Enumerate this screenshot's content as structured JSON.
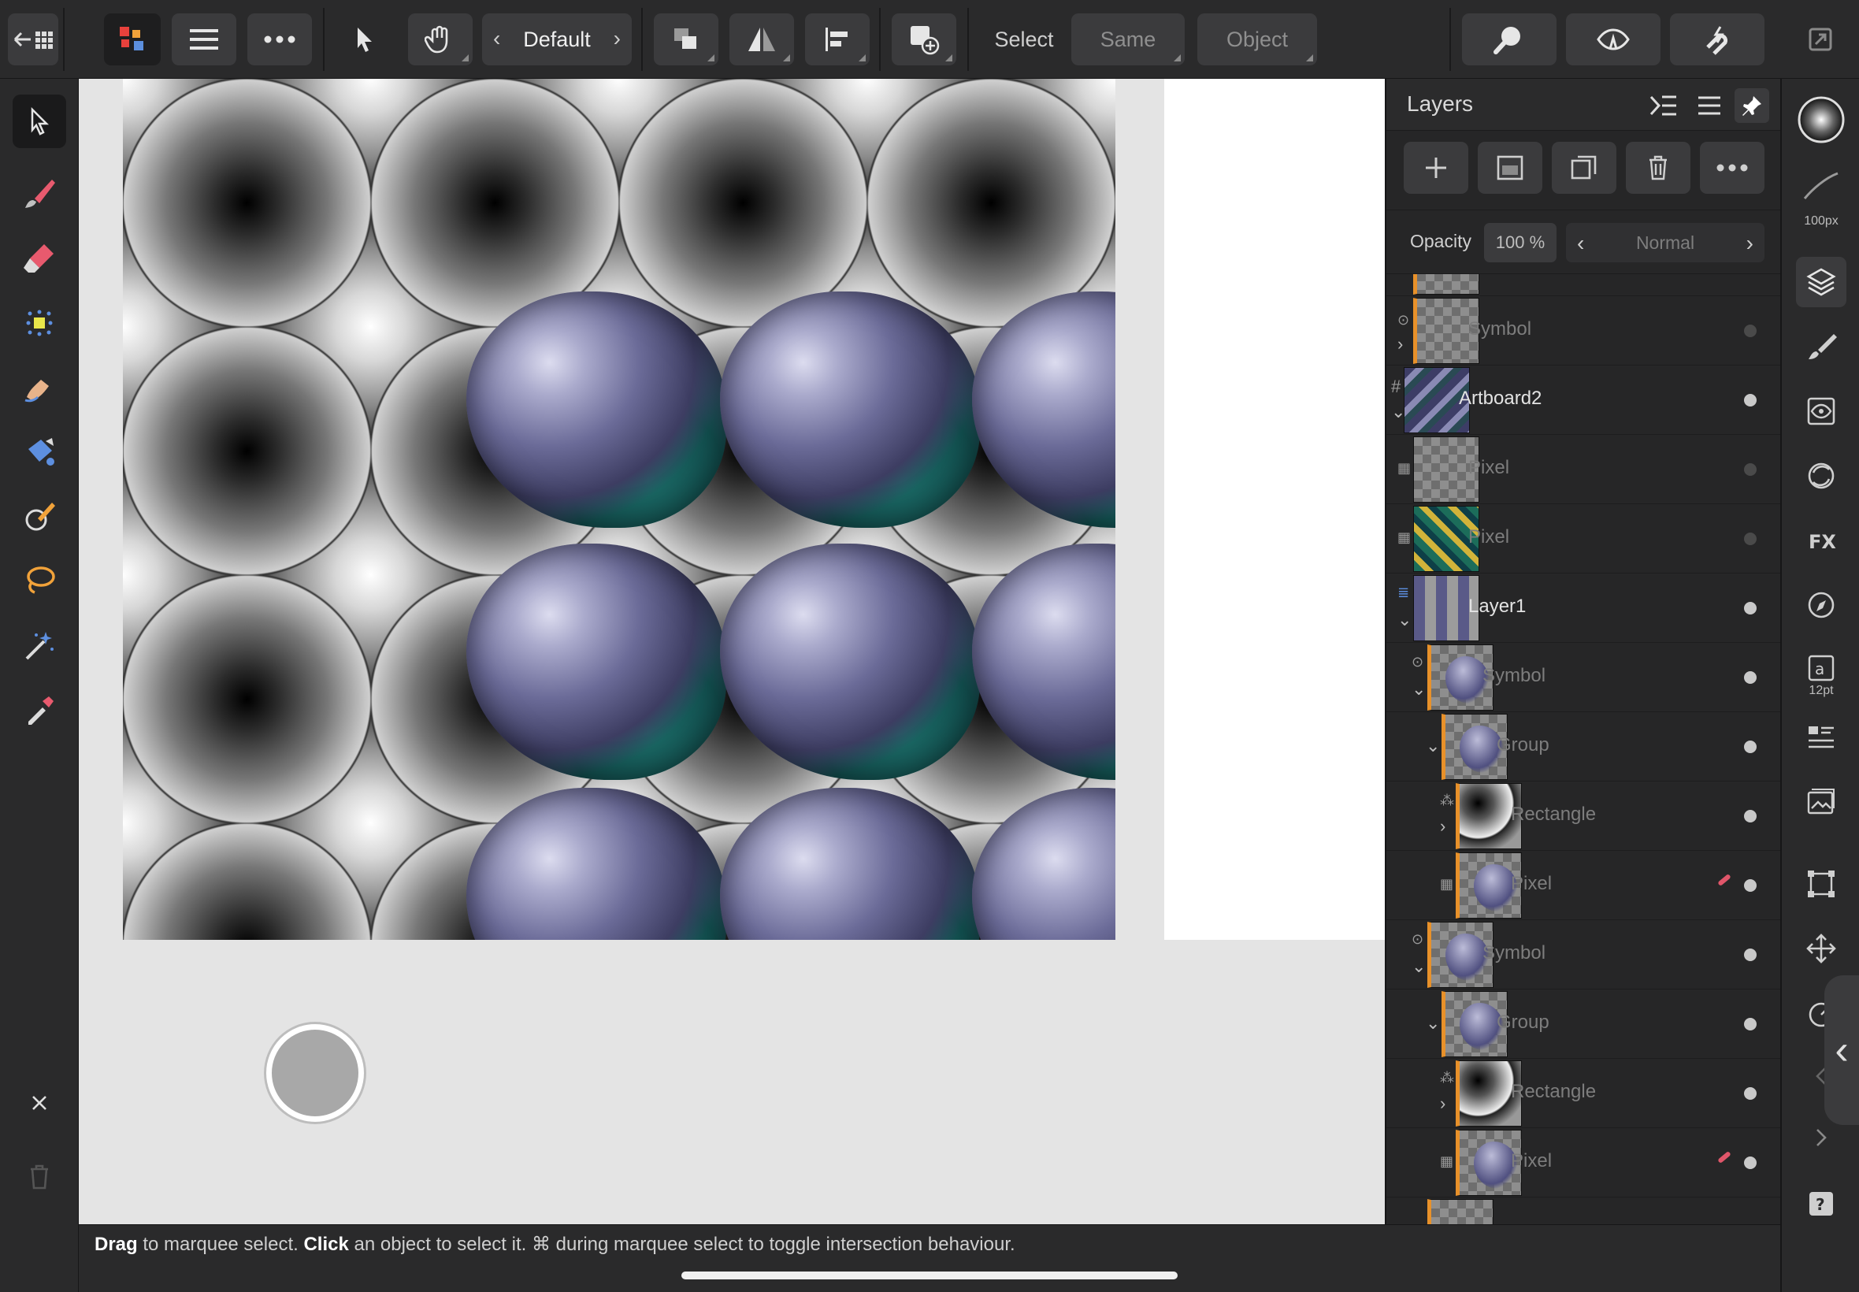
{
  "toolbar": {
    "preset": "Default",
    "select_label": "Select",
    "same_label": "Same",
    "object_label": "Object"
  },
  "layers_panel": {
    "title": "Layers",
    "opacity_label": "Opacity",
    "opacity_value": "100 %",
    "blend_mode": "Normal",
    "rows": [
      {
        "name": "Symbol",
        "kind": "symbol"
      },
      {
        "name": "Artboard2",
        "kind": "artboard"
      },
      {
        "name": "Pixel",
        "kind": "pixel"
      },
      {
        "name": "Pixel",
        "kind": "pixel"
      },
      {
        "name": "Layer1",
        "kind": "layer"
      },
      {
        "name": "Symbol",
        "kind": "symbol"
      },
      {
        "name": "Group",
        "kind": "group"
      },
      {
        "name": "Rectangle",
        "kind": "rectangle"
      },
      {
        "name": "Pixel",
        "kind": "pixel"
      },
      {
        "name": "Symbol",
        "kind": "symbol"
      },
      {
        "name": "Group",
        "kind": "group"
      },
      {
        "name": "Rectangle",
        "kind": "rectangle"
      },
      {
        "name": "Pixel",
        "kind": "pixel"
      }
    ]
  },
  "studio": {
    "brush_size": "100px",
    "text_size": "12pt"
  },
  "status": {
    "drag_word": "Drag",
    "drag_text": " to marquee select. ",
    "click_word": "Click",
    "click_text": " an object to select it. ⌘ during marquee select to toggle intersection behaviour."
  },
  "colors": {
    "accent_orange": "#e8912a",
    "panel_bg": "#262627",
    "toolbar_bg": "#2a2a2b",
    "canvas_bg": "#e4e4e4"
  }
}
